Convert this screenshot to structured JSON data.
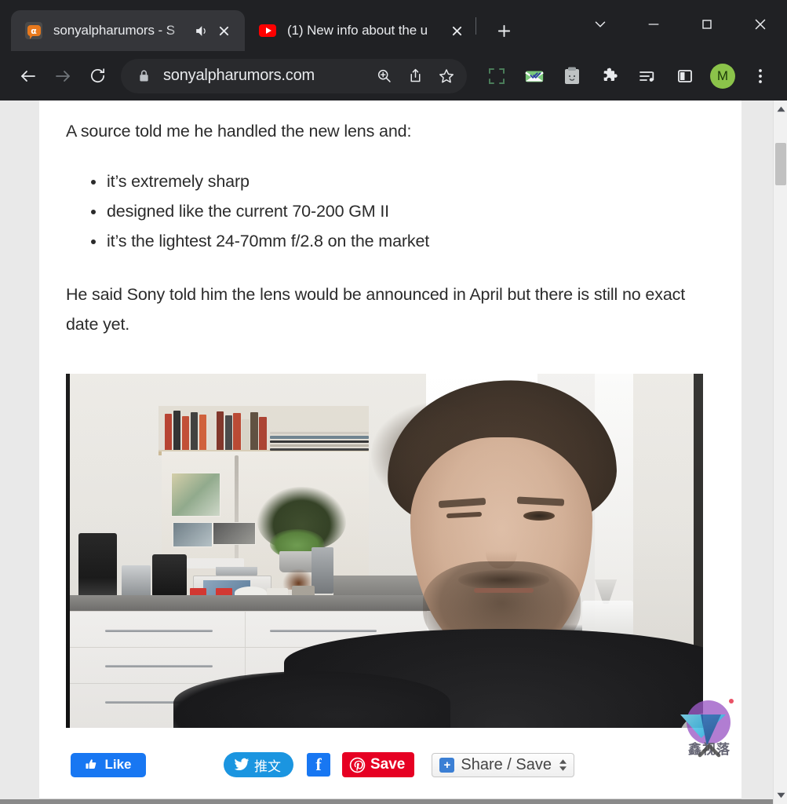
{
  "window": {
    "controls": {
      "chevron_down": "⌄",
      "minimize": "—",
      "maximize": "□",
      "close": "✕"
    }
  },
  "tabs": [
    {
      "title": "sonyalpharumors - S",
      "favicon": "sonyalpharumors-favicon",
      "active": true,
      "audio_playing": true,
      "close_label": "✕"
    },
    {
      "title": "(1) New info about the u",
      "favicon": "youtube-favicon",
      "active": false,
      "audio_playing": false,
      "close_label": "✕"
    }
  ],
  "new_tab_label": "+",
  "toolbar": {
    "back_label": "←",
    "forward_label": "→",
    "reload_label": "⟳",
    "site_security": "lock-icon",
    "url": "sonyalpharumors.com",
    "zoom_label": "zoom-in-icon",
    "share_label": "share-icon",
    "bookmark_label": "star-icon",
    "extensions": [
      "capture-selection-icon",
      "mail-envelope-icon",
      "clipboard-icon",
      "puzzle-piece-icon",
      "reading-playlist-icon",
      "side-panel-icon"
    ],
    "profile_initial": "M",
    "menu_label": "⋮"
  },
  "article": {
    "intro": "A source told me he handled the new lens and:",
    "bullets": [
      "it’s extremely sharp",
      "designed like the current 70-200 GM II",
      "it’s the lightest 24-70mm f/2.8 on the market"
    ],
    "closing": "He said Sony told him the lens would be announced in April but there is still no exact date yet.",
    "media": {
      "type": "video-thumbnail",
      "description": "Man with dark hair and beard in a kitchen, one eye closed, white cabinets and bookshelf behind"
    }
  },
  "social": {
    "facebook_like": "Like",
    "twitter_tweet": "推文",
    "facebook_share": "f",
    "pinterest_save": "Save",
    "addthis": "Share / Save"
  },
  "watermark": {
    "text": "鑫视落"
  },
  "scrollbar": {
    "up_label": "▲",
    "down_label": "▼"
  },
  "colors": {
    "chrome_bg": "#202124",
    "tab_active": "#35363a",
    "omnibox": "#292a2d",
    "facebook_blue": "#1877f2",
    "twitter_blue": "#1b95e0",
    "pinterest_red": "#e60023",
    "avatar_green": "#8bc34a",
    "favicon_orange": "#e8791d",
    "youtube_red": "#ff0000"
  }
}
